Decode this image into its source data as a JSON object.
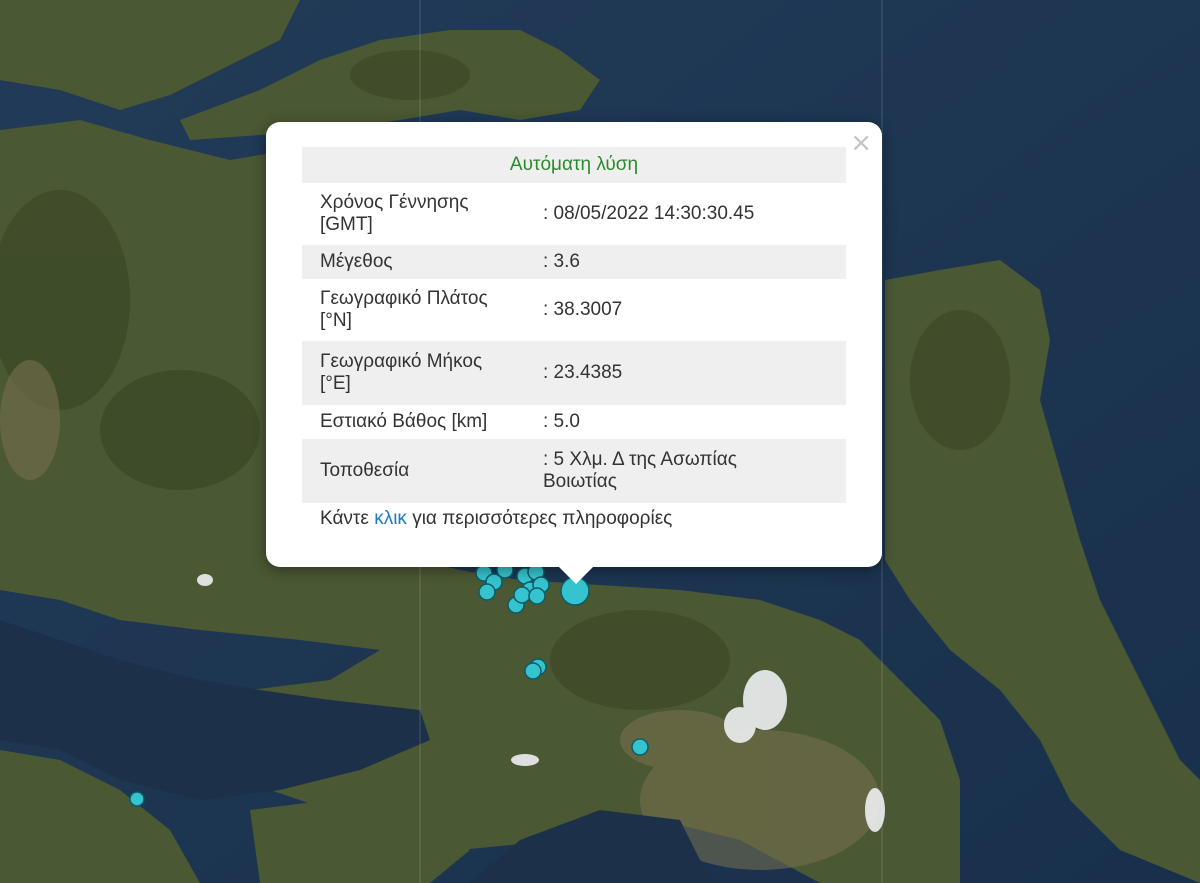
{
  "map": {
    "colors": {
      "sea": "#1d3550",
      "land": "#4c5a33",
      "marker_fill": "#35c4cf",
      "marker_stroke": "#0c5b66"
    },
    "markers": [
      {
        "lat": 38.3007,
        "lon": 23.4385,
        "magnitude": 3.6
      }
    ]
  },
  "popup": {
    "header": "Αυτόματη λύση",
    "close_icon": "×",
    "rows": [
      {
        "label_line1": "Χρόνος Γέννησης",
        "label_line2": "[GMT]",
        "value": ": 08/05/2022 14:30:30.45"
      },
      {
        "label_line1": "Μέγεθος",
        "label_line2": "",
        "value": ": 3.6"
      },
      {
        "label_line1": "Γεωγραφικό Πλάτος",
        "label_line2": "[°N]",
        "value": ": 38.3007"
      },
      {
        "label_line1": "Γεωγραφικό Μήκος",
        "label_line2": "[°E]",
        "value": ": 23.4385"
      },
      {
        "label_line1": "Εστιακό Βάθος [km]",
        "label_line2": "",
        "value": ": 5.0"
      },
      {
        "label_line1": "Τοποθεσία",
        "label_line2": "",
        "value_line1": ": 5 Χλμ. Δ της Ασωπίας",
        "value_line2": "Βοιωτίας"
      }
    ],
    "more": {
      "prefix": "Κάντε ",
      "link": "κλικ",
      "suffix": " για περισσότερες πληροφορίες"
    }
  }
}
